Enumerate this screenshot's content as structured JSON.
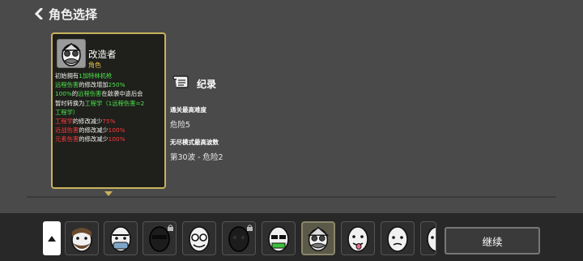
{
  "header": {
    "back_icon": "chevron-left-icon",
    "title": "角色选择"
  },
  "card": {
    "portrait_icon": "engineer-portrait-icon",
    "name": "改造者",
    "tag": "角色",
    "lines": [
      [
        {
          "t": "初始拥有",
          "c": "w"
        },
        {
          "t": "1加特林机枪",
          "c": "g"
        }
      ],
      [
        {
          "t": "远程伤害",
          "c": "g"
        },
        {
          "t": "的修改增加",
          "c": "w"
        },
        {
          "t": "250%",
          "c": "g"
        }
      ],
      [
        {
          "t": "100%",
          "c": "g"
        },
        {
          "t": "的",
          "c": "w"
        },
        {
          "t": "远程伤害",
          "c": "g"
        },
        {
          "t": "在敌袭中途后会",
          "c": "w"
        }
      ],
      [
        {
          "t": "暂时转换为",
          "c": "w"
        },
        {
          "t": "工程学",
          "c": "g"
        },
        {
          "t": "（1远程伤害=2",
          "c": "g"
        }
      ],
      [
        {
          "t": "工程学）",
          "c": "g"
        }
      ],
      [
        {
          "t": "工程学",
          "c": "r"
        },
        {
          "t": "的修改减少",
          "c": "w"
        },
        {
          "t": "75%",
          "c": "r"
        }
      ],
      [
        {
          "t": "近战伤害",
          "c": "r"
        },
        {
          "t": "的修改减少",
          "c": "w"
        },
        {
          "t": "100%",
          "c": "r"
        }
      ],
      [
        {
          "t": "元素伤害",
          "c": "r"
        },
        {
          "t": "的修改减少",
          "c": "w"
        },
        {
          "t": "100%",
          "c": "r"
        }
      ]
    ]
  },
  "records": {
    "icon": "scroll-icon",
    "title": "纪录",
    "best_difficulty_label": "通关最高难度",
    "best_difficulty_value": "危险5",
    "endless_label": "无尽模式最高波数",
    "endless_value": "第30波 - 危险2"
  },
  "characters": [
    {
      "name": "bearded-character-icon",
      "locked": false,
      "selected": false
    },
    {
      "name": "masked-character-icon",
      "locked": false,
      "selected": false
    },
    {
      "name": "shadow-character-icon",
      "locked": true,
      "selected": false
    },
    {
      "name": "glasses-character-icon",
      "locked": false,
      "selected": false
    },
    {
      "name": "dark-character-icon",
      "locked": true,
      "selected": false
    },
    {
      "name": "money-character-icon",
      "locked": false,
      "selected": false
    },
    {
      "name": "engineer-character-icon",
      "locked": false,
      "selected": true
    },
    {
      "name": "tongue-character-icon",
      "locked": false,
      "selected": false
    },
    {
      "name": "sad-character-icon",
      "locked": false,
      "selected": false
    },
    {
      "name": "partial-character-icon",
      "locked": false,
      "selected": false
    }
  ],
  "buttons": {
    "scroll_up_icon": "arrow-up-icon",
    "continue": "继续"
  },
  "colors": {
    "background": "#4a4a4a",
    "card_border": "#c9b25d",
    "positive": "#4ce64c",
    "negative": "#ff3b3b",
    "tag": "#e8c247"
  }
}
